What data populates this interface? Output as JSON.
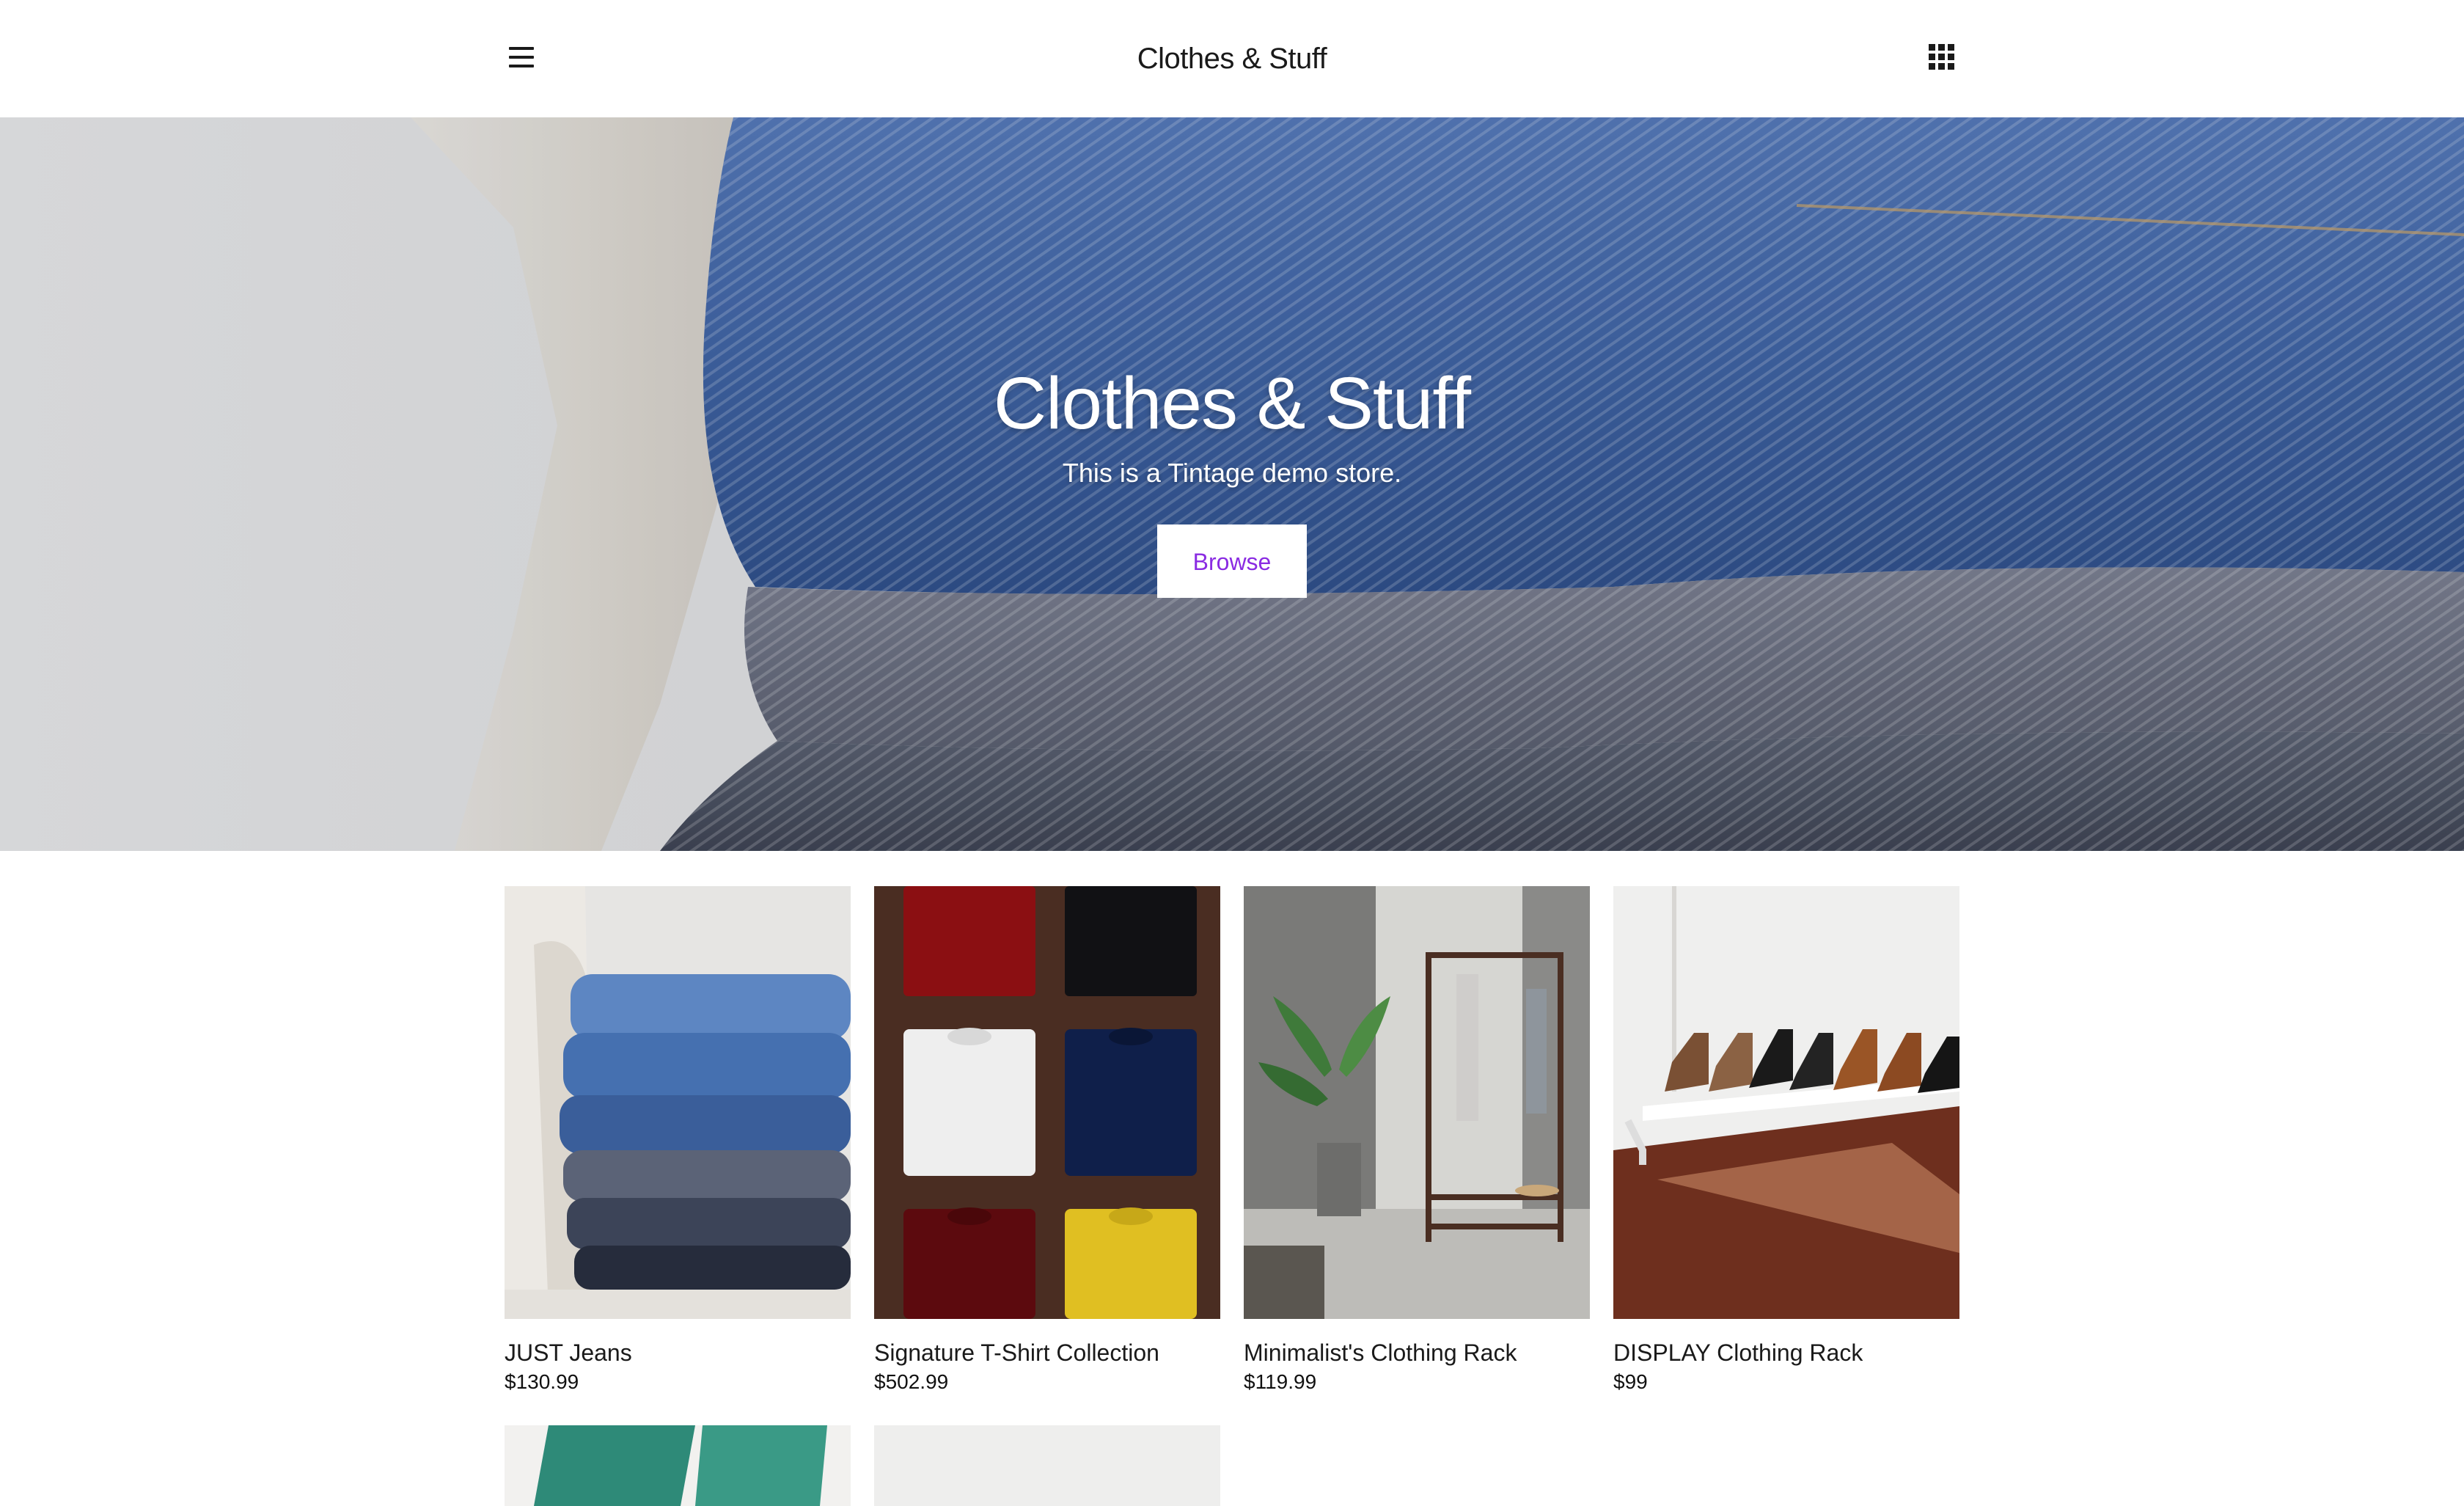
{
  "header": {
    "brand": "Clothes & Stuff",
    "menu_icon": "hamburger-menu-icon",
    "apps_icon": "grid-apps-icon"
  },
  "hero": {
    "title": "Clothes & Stuff",
    "subtitle": "This is a Tintage demo store.",
    "button_label": "Browse",
    "button_color": "#8a2be2"
  },
  "products": [
    {
      "name": "JUST Jeans",
      "price": "$130.99"
    },
    {
      "name": "Signature T-Shirt Collection",
      "price": "$502.99"
    },
    {
      "name": "Minimalist's Clothing Rack",
      "price": "$119.99"
    },
    {
      "name": "DISPLAY Clothing Rack",
      "price": "$99"
    }
  ],
  "colors": {
    "accent": "#8a2be2",
    "text": "#1a1a1a",
    "background": "#ffffff"
  }
}
